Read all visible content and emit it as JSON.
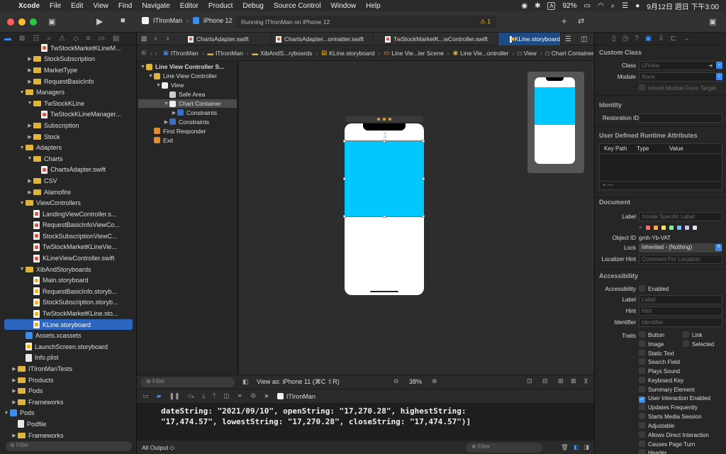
{
  "menubar": {
    "items": [
      "Xcode",
      "File",
      "Edit",
      "View",
      "Find",
      "Navigate",
      "Editor",
      "Product",
      "Debug",
      "Source Control",
      "Window",
      "Help"
    ],
    "battery": "92%",
    "datetime": "9月12日 週日 下午3:00"
  },
  "toolbar": {
    "scheme": "ITIronMan",
    "device": "iPhone 12",
    "status": "Running ITIronMan on iPhone 12",
    "warning_count": "1"
  },
  "navigator": {
    "items": [
      {
        "label": "TwStockMarketKLineM...",
        "indent": 4,
        "kind": "swift",
        "tri": ""
      },
      {
        "label": "StockSubscription",
        "indent": 3,
        "kind": "folder",
        "tri": "▶"
      },
      {
        "label": "MarketType",
        "indent": 3,
        "kind": "folder",
        "tri": "▶"
      },
      {
        "label": "RequestBasicInfo",
        "indent": 3,
        "kind": "folder",
        "tri": "▶"
      },
      {
        "label": "Managers",
        "indent": 2,
        "kind": "folder",
        "tri": "▼"
      },
      {
        "label": "TwStockKLine",
        "indent": 3,
        "kind": "folder",
        "tri": "▼"
      },
      {
        "label": "TwStockKLineManager...",
        "indent": 4,
        "kind": "swift",
        "tri": ""
      },
      {
        "label": "Subscription",
        "indent": 3,
        "kind": "folder",
        "tri": "▶"
      },
      {
        "label": "Stock",
        "indent": 3,
        "kind": "folder",
        "tri": "▶"
      },
      {
        "label": "Adapters",
        "indent": 2,
        "kind": "folder",
        "tri": "▼"
      },
      {
        "label": "Charts",
        "indent": 3,
        "kind": "folder",
        "tri": "▼"
      },
      {
        "label": "ChartsAdapter.swift",
        "indent": 4,
        "kind": "swift",
        "tri": ""
      },
      {
        "label": "CSV",
        "indent": 3,
        "kind": "folder",
        "tri": "▶"
      },
      {
        "label": "Alamofire",
        "indent": 3,
        "kind": "folder",
        "tri": "▶"
      },
      {
        "label": "ViewControllers",
        "indent": 2,
        "kind": "folder",
        "tri": "▼"
      },
      {
        "label": "LandingViewController.s...",
        "indent": 3,
        "kind": "swift",
        "tri": ""
      },
      {
        "label": "RequestBasicInfoViewCo...",
        "indent": 3,
        "kind": "swift",
        "tri": ""
      },
      {
        "label": "StockSubscriptionViewC...",
        "indent": 3,
        "kind": "swift",
        "tri": ""
      },
      {
        "label": "TwStockMarketKLineVie...",
        "indent": 3,
        "kind": "swift",
        "tri": ""
      },
      {
        "label": "KLineViewController.swift",
        "indent": 3,
        "kind": "swift",
        "tri": ""
      },
      {
        "label": "XibAndStoryboards",
        "indent": 2,
        "kind": "folder",
        "tri": "▼"
      },
      {
        "label": "Main.storyboard",
        "indent": 3,
        "kind": "sb",
        "tri": ""
      },
      {
        "label": "RequestBasicInfo.storyb...",
        "indent": 3,
        "kind": "sb",
        "tri": ""
      },
      {
        "label": "StockSubscription.storyb...",
        "indent": 3,
        "kind": "sb",
        "tri": ""
      },
      {
        "label": "TwStockMarketKLine.sto...",
        "indent": 3,
        "kind": "sb",
        "tri": ""
      },
      {
        "label": "KLine.storyboard",
        "indent": 3,
        "kind": "sb",
        "tri": "",
        "selected": true
      },
      {
        "label": "Assets.xcassets",
        "indent": 2,
        "kind": "assets",
        "tri": ""
      },
      {
        "label": "LaunchScreen.storyboard",
        "indent": 2,
        "kind": "sb",
        "tri": ""
      },
      {
        "label": "Info.plist",
        "indent": 2,
        "kind": "plist",
        "tri": ""
      },
      {
        "label": "ITIronManTests",
        "indent": 1,
        "kind": "folder",
        "tri": "▶"
      },
      {
        "label": "Products",
        "indent": 1,
        "kind": "folder",
        "tri": "▶"
      },
      {
        "label": "Pods",
        "indent": 1,
        "kind": "folder",
        "tri": "▶"
      },
      {
        "label": "Frameworks",
        "indent": 1,
        "kind": "folder",
        "tri": "▶"
      },
      {
        "label": "Pods",
        "indent": 0,
        "kind": "proj",
        "tri": "▼"
      },
      {
        "label": "Podfile",
        "indent": 1,
        "kind": "plist",
        "tri": ""
      },
      {
        "label": "Frameworks",
        "indent": 1,
        "kind": "folder",
        "tri": "▶"
      }
    ],
    "filter_placeholder": "Filter"
  },
  "tabs": [
    {
      "label": "ChartsAdapter.swift",
      "kind": "swift"
    },
    {
      "label": "ChartsAdapter...ormatter.swift",
      "kind": "swift"
    },
    {
      "label": "TwStockMarketK...wController.swift",
      "kind": "swift"
    },
    {
      "label": "KLine.storyboard",
      "kind": "sb",
      "active": true
    }
  ],
  "jumpbar": [
    "ITIronMan",
    "ITIronMan",
    "XibAndS...ryboards",
    "KLine.storyboard",
    "Line Vie...ler Scene",
    "Line Vie...ontroller",
    "View",
    "Chart Container"
  ],
  "outline": {
    "items": [
      {
        "label": "Line View Controller S...",
        "indent": 0,
        "tri": "▼",
        "color": "#e0b33a",
        "bold": true
      },
      {
        "label": "Line View Controller",
        "indent": 1,
        "tri": "▼",
        "color": "#e0b33a"
      },
      {
        "label": "View",
        "indent": 2,
        "tri": "▼",
        "color": "#f0f0f0"
      },
      {
        "label": "Safe Area",
        "indent": 3,
        "tri": "",
        "color": "#cfcfcf"
      },
      {
        "label": "Chart Container",
        "indent": 3,
        "tri": "▼",
        "color": "#f0f0f0",
        "selected": true
      },
      {
        "label": "Constraints",
        "indent": 4,
        "tri": "▶",
        "color": "#3c6fc4"
      },
      {
        "label": "Constraints",
        "indent": 3,
        "tri": "▶",
        "color": "#3c6fc4"
      },
      {
        "label": "First Responder",
        "indent": 1,
        "tri": "",
        "color": "#e68a2e"
      },
      {
        "label": "Exit",
        "indent": 1,
        "tri": "",
        "color": "#e68a2e"
      }
    ],
    "filter_placeholder": "Filter"
  },
  "canvas": {
    "view_as": "View as: iPhone 11 (⌘C ⇧R)",
    "zoom": "38%"
  },
  "debug": {
    "target": "ITIronMan",
    "console_line1": "dateString: \"2021/09/10\", openString: \"17,270.28\", highestString:",
    "console_line2": "\"17,474.57\", lowestString: \"17,270.28\", closeString: \"17,474.57\")]",
    "output_select": "All Output ◇",
    "filter_placeholder": "Filter"
  },
  "inspector": {
    "custom_class_title": "Custom Class",
    "class_label": "Class",
    "class_placeholder": "UIView",
    "module_label": "Module",
    "module_placeholder": "None",
    "inherit_label": "Inherit Module From Target",
    "identity_title": "Identity",
    "restoration_label": "Restoration ID",
    "runtime_title": "User Defined Runtime Attributes",
    "col_keypath": "Key Path",
    "col_type": "Type",
    "col_value": "Value",
    "document_title": "Document",
    "doc_label_label": "Label",
    "doc_label_placeholder": "Xcode Specific Label",
    "object_id_label": "Object ID",
    "object_id_value": "gmh-Yb-VAT",
    "lock_label": "Lock",
    "lock_value": "Inherited - (Nothing)",
    "localizer_label": "Localizer Hint",
    "localizer_placeholder": "Comment For Localizer",
    "accessibility_title": "Accessibility",
    "acc_label": "Accessibility",
    "acc_enabled": "Enabled",
    "label_label": "Label",
    "label_placeholder": "Label",
    "hint_label": "Hint",
    "hint_placeholder": "Hint",
    "identifier_label": "Identifier",
    "identifier_placeholder": "Identifier",
    "traits_label": "Traits",
    "traits_left": [
      "Button",
      "Image",
      "Static Text",
      "Search Field",
      "Plays Sound",
      "Keyboard Key",
      "Summary Element",
      "User Interaction Enabled",
      "Updates Frequently",
      "Starts Media Session",
      "Adjustable",
      "Allows Direct Interaction",
      "Causes Page Turn",
      "Header"
    ],
    "traits_right": [
      "Link",
      "Selected"
    ],
    "checked_trait": "User Interaction Enabled",
    "label_colors": [
      "#ff6b6b",
      "#ffa94d",
      "#ffe066",
      "#8ce99a",
      "#74c0fc",
      "#d0bfff",
      "#dee2e6"
    ]
  },
  "colors": {
    "accent": "#3c8cf0",
    "chart_container": "#00c8ff",
    "selection": "#2c65c0"
  }
}
